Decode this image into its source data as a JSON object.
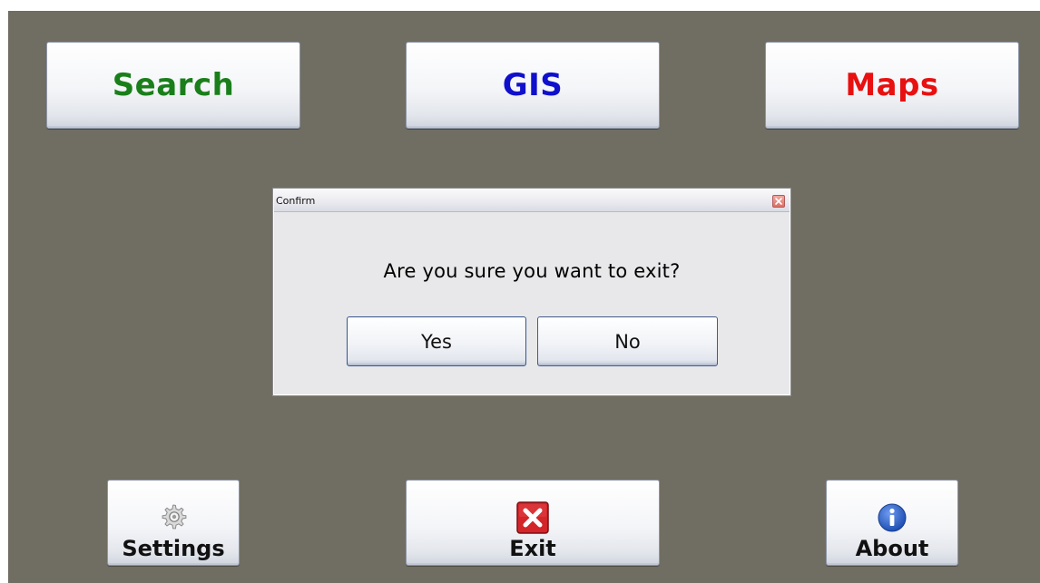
{
  "main_menu": {
    "search_label": "Search",
    "gis_label": "GIS",
    "maps_label": "Maps"
  },
  "toolbar": {
    "settings_label": "Settings",
    "exit_label": "Exit",
    "about_label": "About"
  },
  "dialog": {
    "title": "Confirm",
    "message": "Are you sure you want to exit?",
    "yes_label": "Yes",
    "no_label": "No"
  },
  "icons": {
    "settings": "gear-icon",
    "exit": "red-x-icon",
    "about": "info-icon",
    "dialog_close": "close-icon"
  },
  "colors": {
    "background": "#706d63",
    "search_text": "#1a7f1a",
    "gis_text": "#1010cc",
    "maps_text": "#e81010",
    "exit_icon": "#cc1b1b",
    "about_icon": "#2f62c7"
  }
}
